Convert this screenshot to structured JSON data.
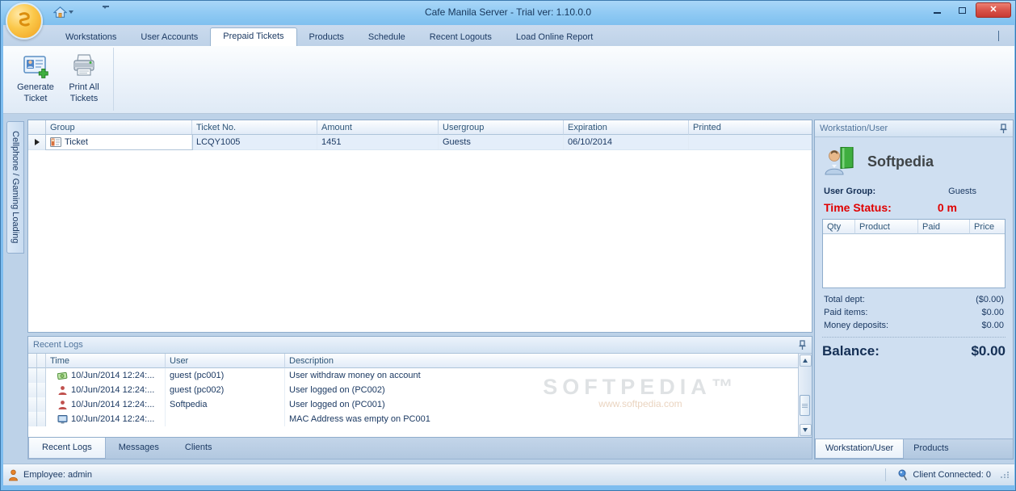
{
  "window": {
    "title": "Cafe Manila Server - Trial ver: 1.10.0.0"
  },
  "colors": {
    "titlebar_blue": "#8ec9f3",
    "close_button_red": "#d9544a",
    "accent_navy": "#1c3a63",
    "status_red": "#e00000",
    "workspace_blue": "#bdd2e8"
  },
  "ribbon": {
    "tabs": [
      {
        "label": "Workstations",
        "active": false
      },
      {
        "label": "User Accounts",
        "active": false
      },
      {
        "label": "Prepaid Tickets",
        "active": true
      },
      {
        "label": "Products",
        "active": false
      },
      {
        "label": "Schedule",
        "active": false
      },
      {
        "label": "Recent Logouts",
        "active": false
      },
      {
        "label": "Load Online Report",
        "active": false
      }
    ],
    "buttons": [
      {
        "label": "Generate Ticket",
        "icon": "id-card-plus-icon"
      },
      {
        "label": "Print All Tickets",
        "icon": "printer-icon"
      }
    ]
  },
  "left_tab": {
    "label": "Cellphone / Gaming Loading"
  },
  "tickets_grid": {
    "columns": [
      "Group",
      "Ticket No.",
      "Amount",
      "Usergroup",
      "Expiration",
      "Printed"
    ],
    "rows": [
      {
        "group": "Ticket",
        "ticket_no": "LCQY1005",
        "amount": "1451",
        "usergroup": "Guests",
        "expiration": "06/10/2014",
        "printed": ""
      }
    ]
  },
  "recent_logs": {
    "title": "Recent Logs",
    "columns": [
      "Time",
      "User",
      "Description"
    ],
    "rows": [
      {
        "icon": "money-icon",
        "time": "10/Jun/2014 12:24:...",
        "user": "guest (pc001)",
        "description": "User withdraw money on account"
      },
      {
        "icon": "user-icon",
        "time": "10/Jun/2014 12:24:...",
        "user": "guest (pc002)",
        "description": "User logged on (PC002)"
      },
      {
        "icon": "user-icon",
        "time": "10/Jun/2014 12:24:...",
        "user": "Softpedia",
        "description": "User logged on (PC001)"
      },
      {
        "icon": "computer-icon",
        "time": "10/Jun/2014 12:24:...",
        "user": "",
        "description": "MAC Address was empty on PC001"
      }
    ],
    "tabs": [
      {
        "label": "Recent Logs",
        "active": true
      },
      {
        "label": "Messages",
        "active": false
      },
      {
        "label": "Clients",
        "active": false
      }
    ]
  },
  "workstation_panel": {
    "title": "Workstation/User",
    "user_name": "Softpedia",
    "user_group_label": "User Group:",
    "user_group_value": "Guests",
    "time_status_label": "Time Status:",
    "time_status_value": "0 m",
    "products_table": {
      "columns": [
        "Qty",
        "Product",
        "Paid",
        "Price"
      ]
    },
    "totals": [
      {
        "label": "Total dept:",
        "value": "($0.00)"
      },
      {
        "label": "Paid items:",
        "value": "$0.00"
      },
      {
        "label": "Money deposits:",
        "value": "$0.00"
      }
    ],
    "balance_label": "Balance:",
    "balance_value": "$0.00",
    "tabs": [
      {
        "label": "Workstation/User",
        "active": true
      },
      {
        "label": "Products",
        "active": false
      }
    ]
  },
  "status_bar": {
    "employee": "Employee: admin",
    "client_connected": "Client Connected: 0"
  },
  "watermark": {
    "line1": "SOFTPEDIA™",
    "line2": "www.softpedia.com"
  }
}
